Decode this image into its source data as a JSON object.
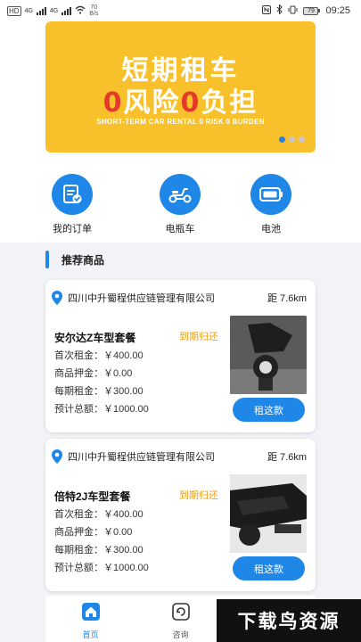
{
  "status_bar": {
    "left_chip": "HD",
    "net_1": "4G",
    "net_2": "4G",
    "speed_top": "70",
    "speed_bottom": "B/s",
    "battery": "79",
    "time": "09:25"
  },
  "banner": {
    "line1": "短期租车",
    "line2_parts": [
      "0",
      "风险",
      "0",
      "负担"
    ],
    "subtitle": "SHORT-TERM CAR RENTAL 0 RISK 0 BURDEN",
    "background": "#f8c02a",
    "accent": "#e53a2b",
    "slides": 3,
    "active_slide": 1
  },
  "categories": [
    {
      "label": "我的订单",
      "icon": "order-document-icon"
    },
    {
      "label": "电瓶车",
      "icon": "scooter-icon"
    },
    {
      "label": "电池",
      "icon": "battery-icon"
    }
  ],
  "section": {
    "title": "推荐商品"
  },
  "cards": [
    {
      "company": "四川中升蜀程供应链管理有限公司",
      "distance": "距 7.6km",
      "title": "安尔达Z车型套餐",
      "status": "到期归还",
      "rows": [
        "首次租金：￥400.00",
        "商品押金：￥0.00",
        "每期租金：￥300.00",
        "预计总额：￥1000.00"
      ],
      "button": "租这款"
    },
    {
      "company": "四川中升蜀程供应链管理有限公司",
      "distance": "距 7.6km",
      "title": "倍特2J车型套餐",
      "status": "到期归还",
      "rows": [
        "首次租金：￥400.00",
        "商品押金：￥0.00",
        "每期租金：￥300.00",
        "预计总额：￥1000.00"
      ],
      "button": "租这款"
    }
  ],
  "tabs": [
    {
      "label": "首页",
      "icon": "home-icon",
      "active": true
    },
    {
      "label": "咨询",
      "icon": "consult-icon",
      "active": false
    }
  ],
  "watermark": "下载鸟资源",
  "colors": {
    "primary": "#1f87e8",
    "warning": "#f0a11b"
  }
}
